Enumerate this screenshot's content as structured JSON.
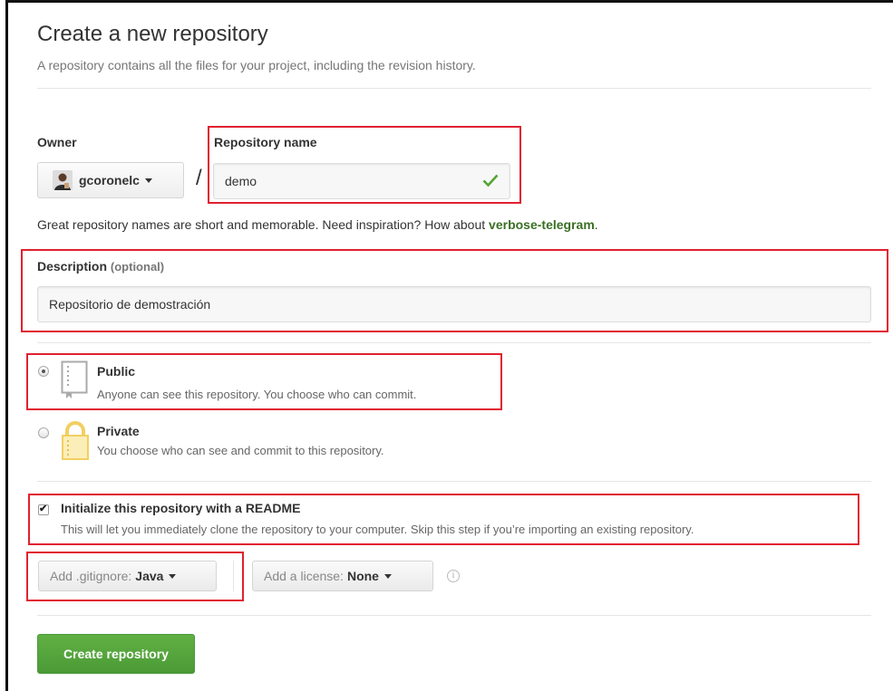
{
  "header": {
    "title": "Create a new repository",
    "subtitle": "A repository contains all the files for your project, including the revision history."
  },
  "owner": {
    "label": "Owner",
    "value": "gcoronelc"
  },
  "repo_name": {
    "label": "Repository name",
    "value": "demo",
    "valid": true
  },
  "hint": {
    "text": "Great repository names are short and memorable. Need inspiration? How about ",
    "suggestion": "verbose-telegram",
    "end": "."
  },
  "description": {
    "label": "Description",
    "optional": "(optional)",
    "value": "Repositorio de demostración"
  },
  "visibility": {
    "public": {
      "title": "Public",
      "desc": "Anyone can see this repository. You choose who can commit.",
      "selected": true
    },
    "private": {
      "title": "Private",
      "desc": "You choose who can see and commit to this repository.",
      "selected": false
    }
  },
  "readme": {
    "title": "Initialize this repository with a README",
    "desc": "This will let you immediately clone the repository to your computer. Skip this step if you’re importing an existing repository.",
    "checked": true
  },
  "gitignore": {
    "prefix": "Add .gitignore:",
    "value": "Java"
  },
  "license": {
    "prefix": "Add a license:",
    "value": "None"
  },
  "submit": {
    "label": "Create repository"
  },
  "colors": {
    "highlight": "#e02030",
    "primary": "#5aab3f",
    "link": "#3a6f24"
  }
}
